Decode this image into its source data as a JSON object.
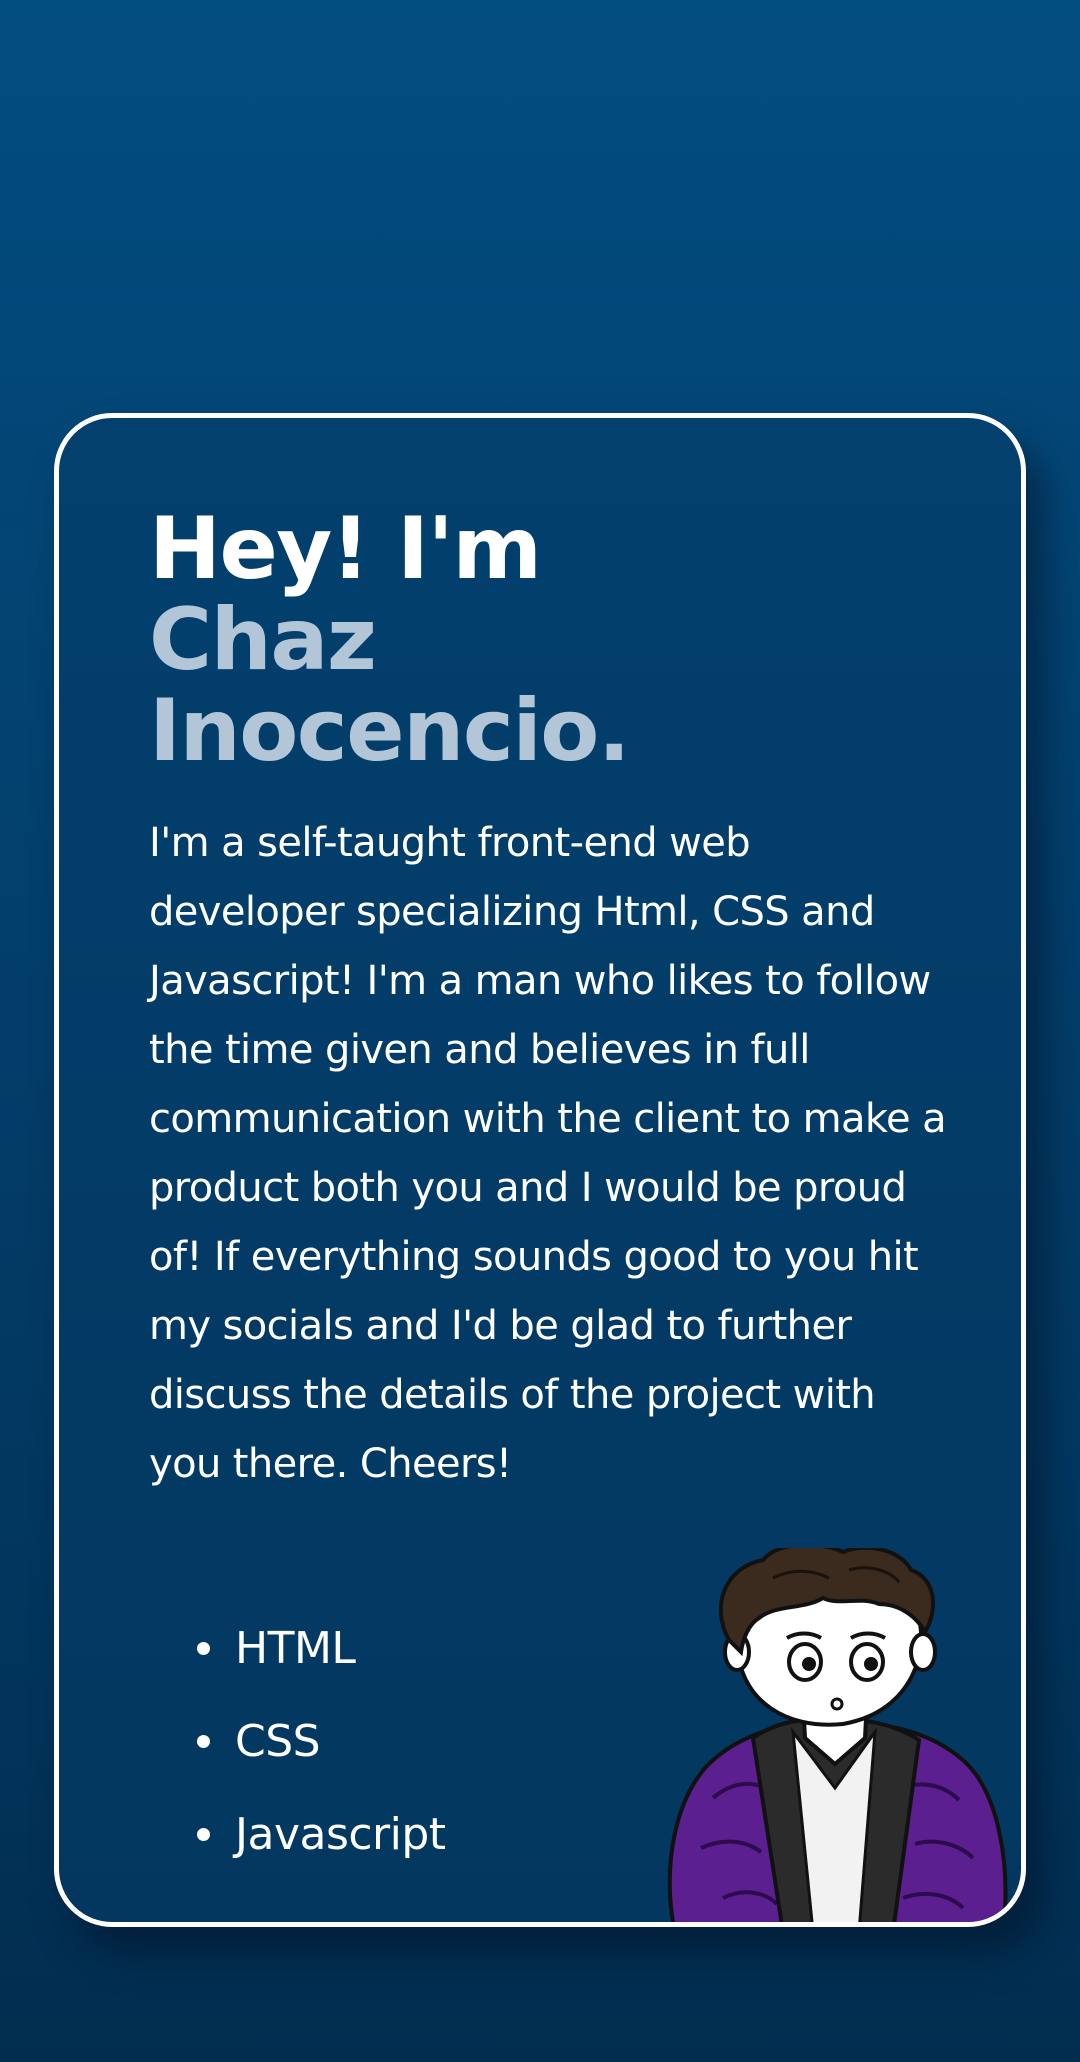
{
  "hero": {
    "greeting": "Hey! I'm",
    "name_line1": "Chaz",
    "name_line2": "Inocencio.",
    "bio": "I'm a self-taught front-end web developer specializing Html, CSS and Javascript! I'm a man who likes to follow the time given and believes in full communication with the client to make a product both you and I would be proud of! If everything sounds good to you hit my socials and I'd be glad to further discuss the details of the project with you there. Cheers!"
  },
  "skills": [
    "HTML",
    "CSS",
    "Javascript"
  ],
  "colors": {
    "background": "#024d80",
    "card_border": "#ffffff",
    "name_accent": "#b2c6d8",
    "jacket": "#5b1f8f"
  },
  "avatar": {
    "icon": "cartoon-avatar-purple-jacket"
  }
}
